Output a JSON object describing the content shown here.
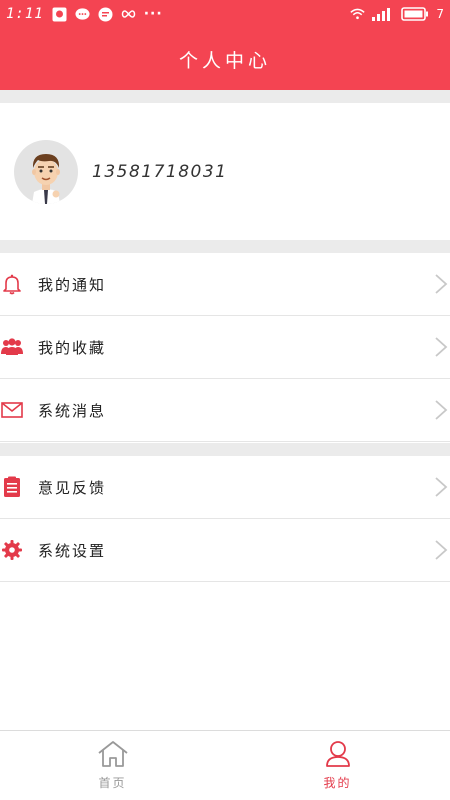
{
  "status_bar": {
    "time": "1:11",
    "more_dots": "···",
    "battery_text": "7"
  },
  "header": {
    "title": "个人中心"
  },
  "profile": {
    "phone": "13581718031"
  },
  "menu_group_1": [
    {
      "label": "我的通知",
      "icon": "bell-icon"
    },
    {
      "label": "我的收藏",
      "icon": "users-icon"
    },
    {
      "label": "系统消息",
      "icon": "envelope-icon"
    }
  ],
  "menu_group_2": [
    {
      "label": "意见反馈",
      "icon": "clipboard-icon"
    },
    {
      "label": "系统设置",
      "icon": "gear-icon"
    }
  ],
  "tab_bar": {
    "home_label": "首页",
    "mine_label": "我的"
  },
  "colors": {
    "brand": "#f44452",
    "icon_red": "#e33a4a",
    "divider": "#ebebeb"
  }
}
